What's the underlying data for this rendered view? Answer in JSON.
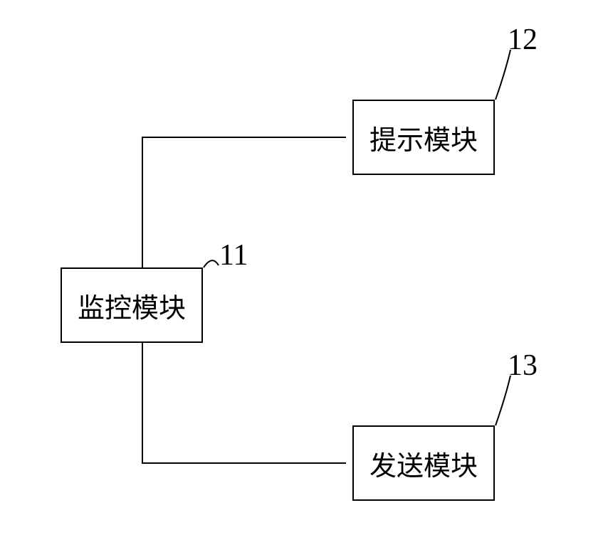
{
  "diagram": {
    "boxes": {
      "monitor": {
        "label": "监控模块",
        "ref": "11"
      },
      "prompt": {
        "label": "提示模块",
        "ref": "12"
      },
      "send": {
        "label": "发送模块",
        "ref": "13"
      }
    }
  }
}
